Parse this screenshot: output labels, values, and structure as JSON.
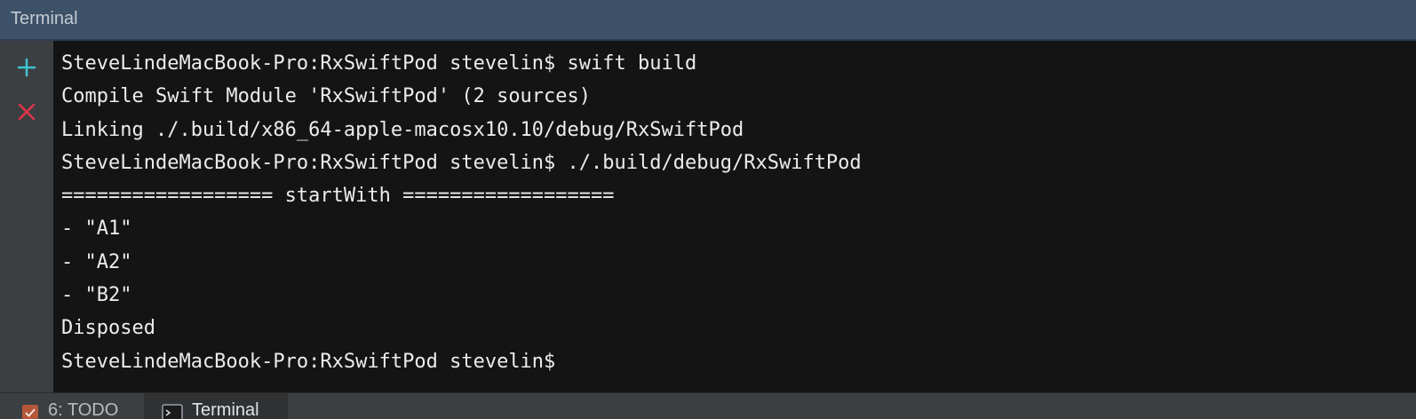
{
  "window": {
    "title": "Terminal"
  },
  "toolbar": {
    "new_session_icon": "plus-icon",
    "close_session_icon": "close-icon"
  },
  "terminal": {
    "lines": [
      "SteveLindeMacBook-Pro:RxSwiftPod stevelin$ swift build",
      "Compile Swift Module 'RxSwiftPod' (2 sources)",
      "Linking ./.build/x86_64-apple-macosx10.10/debug/RxSwiftPod",
      "SteveLindeMacBook-Pro:RxSwiftPod stevelin$ ./.build/debug/RxSwiftPod",
      "================== startWith ==================",
      "- \"A1\"",
      "- \"A2\"",
      "- \"B2\"",
      "Disposed",
      "SteveLindeMacBook-Pro:RxSwiftPod stevelin$"
    ]
  },
  "bottom_tabs": {
    "todo_label": "6: TODO",
    "terminal_label": "Terminal"
  },
  "colors": {
    "title_bar": "#3d5168",
    "terminal_bg": "#141414",
    "terminal_text": "#ececec",
    "plus_icon": "#3fc5d0",
    "close_icon": "#e2334a"
  }
}
